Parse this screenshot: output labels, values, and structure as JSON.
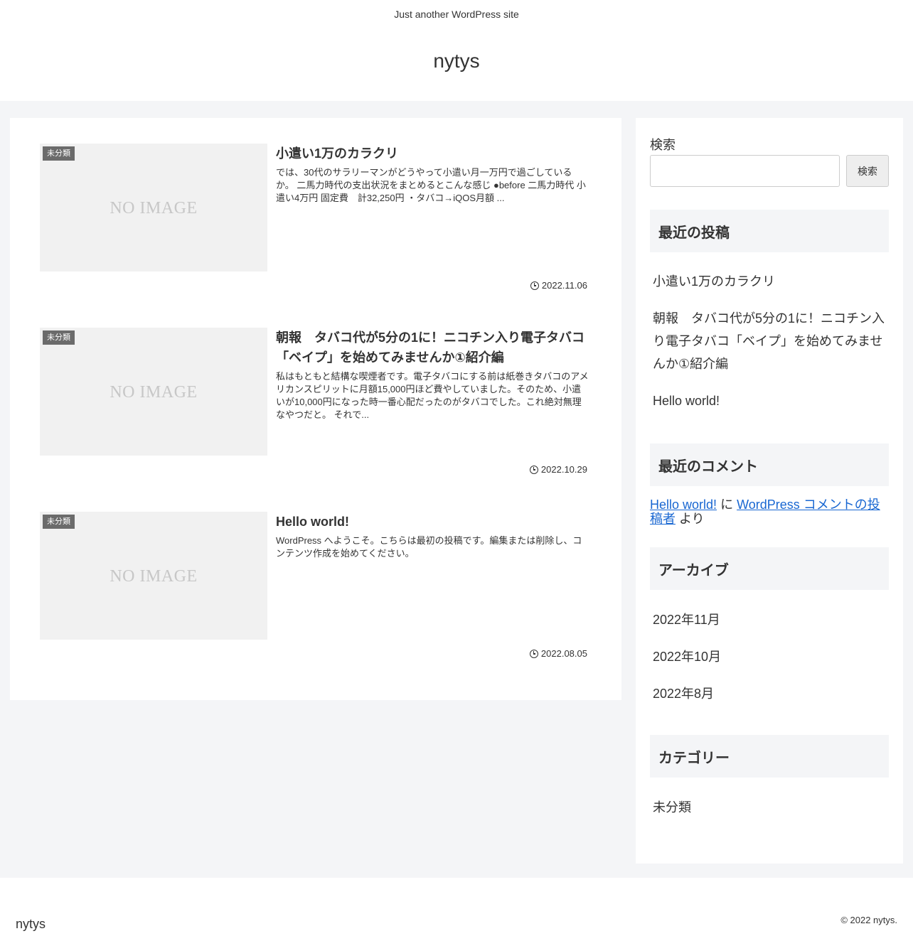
{
  "header": {
    "tagline": "Just another WordPress site",
    "site_title": "nytys"
  },
  "posts": [
    {
      "category": "未分類",
      "thumb_text": "NO IMAGE",
      "title": "小遣い1万のカラクリ",
      "excerpt": "では、30代のサラリーマンがどうやって小遣い月一万円で過ごしているか。 二馬力時代の支出状況をまとめるとこんな感じ ●before 二馬力時代 小遣い4万円 固定費　計32,250円 ・タバコ→iQOS月額 ...",
      "date": "2022.11.06"
    },
    {
      "category": "未分類",
      "thumb_text": "NO IMAGE",
      "title": "朝報　タバコ代が5分の1に！ニコチン入り電子タバコ「ベイプ」を始めてみませんか①紹介編",
      "excerpt": "私はもともと結構な喫煙者です。電子タバコにする前は紙巻きタバコのアメリカンスピリットに月額15,000円ほど費やしていました。そのため、小遣いが10,000円になった時一番心配だったのがタバコでした。これ絶対無理なやつだと。 それで...",
      "date": "2022.10.29"
    },
    {
      "category": "未分類",
      "thumb_text": "NO IMAGE",
      "title": "Hello world!",
      "excerpt": "WordPress へようこそ。こちらは最初の投稿です。編集または削除し、コンテンツ作成を始めてください。",
      "date": "2022.08.05"
    }
  ],
  "sidebar": {
    "search": {
      "label": "検索",
      "placeholder": "",
      "button_label": "検索"
    },
    "recent_posts": {
      "heading": "最近の投稿",
      "items": [
        "小遣い1万のカラクリ",
        "朝報　タバコ代が5分の1に！ニコチン入り電子タバコ「ベイプ」を始めてみませんか①紹介編",
        "Hello world!"
      ]
    },
    "recent_comments": {
      "heading": "最近のコメント",
      "post_link": "Hello world!",
      "connector": "に",
      "author_link": "WordPress コメントの投稿者",
      "suffix": "より"
    },
    "archives": {
      "heading": "アーカイブ",
      "items": [
        "2022年11月",
        "2022年10月",
        "2022年8月"
      ]
    },
    "categories": {
      "heading": "カテゴリー",
      "items": [
        "未分類"
      ]
    }
  },
  "footer": {
    "site_title": "nytys",
    "copyright": "© 2022 nytys."
  },
  "colors": {
    "background": "#f4f5f7",
    "link": "#1967d2",
    "badge": "#6b6b6b"
  }
}
